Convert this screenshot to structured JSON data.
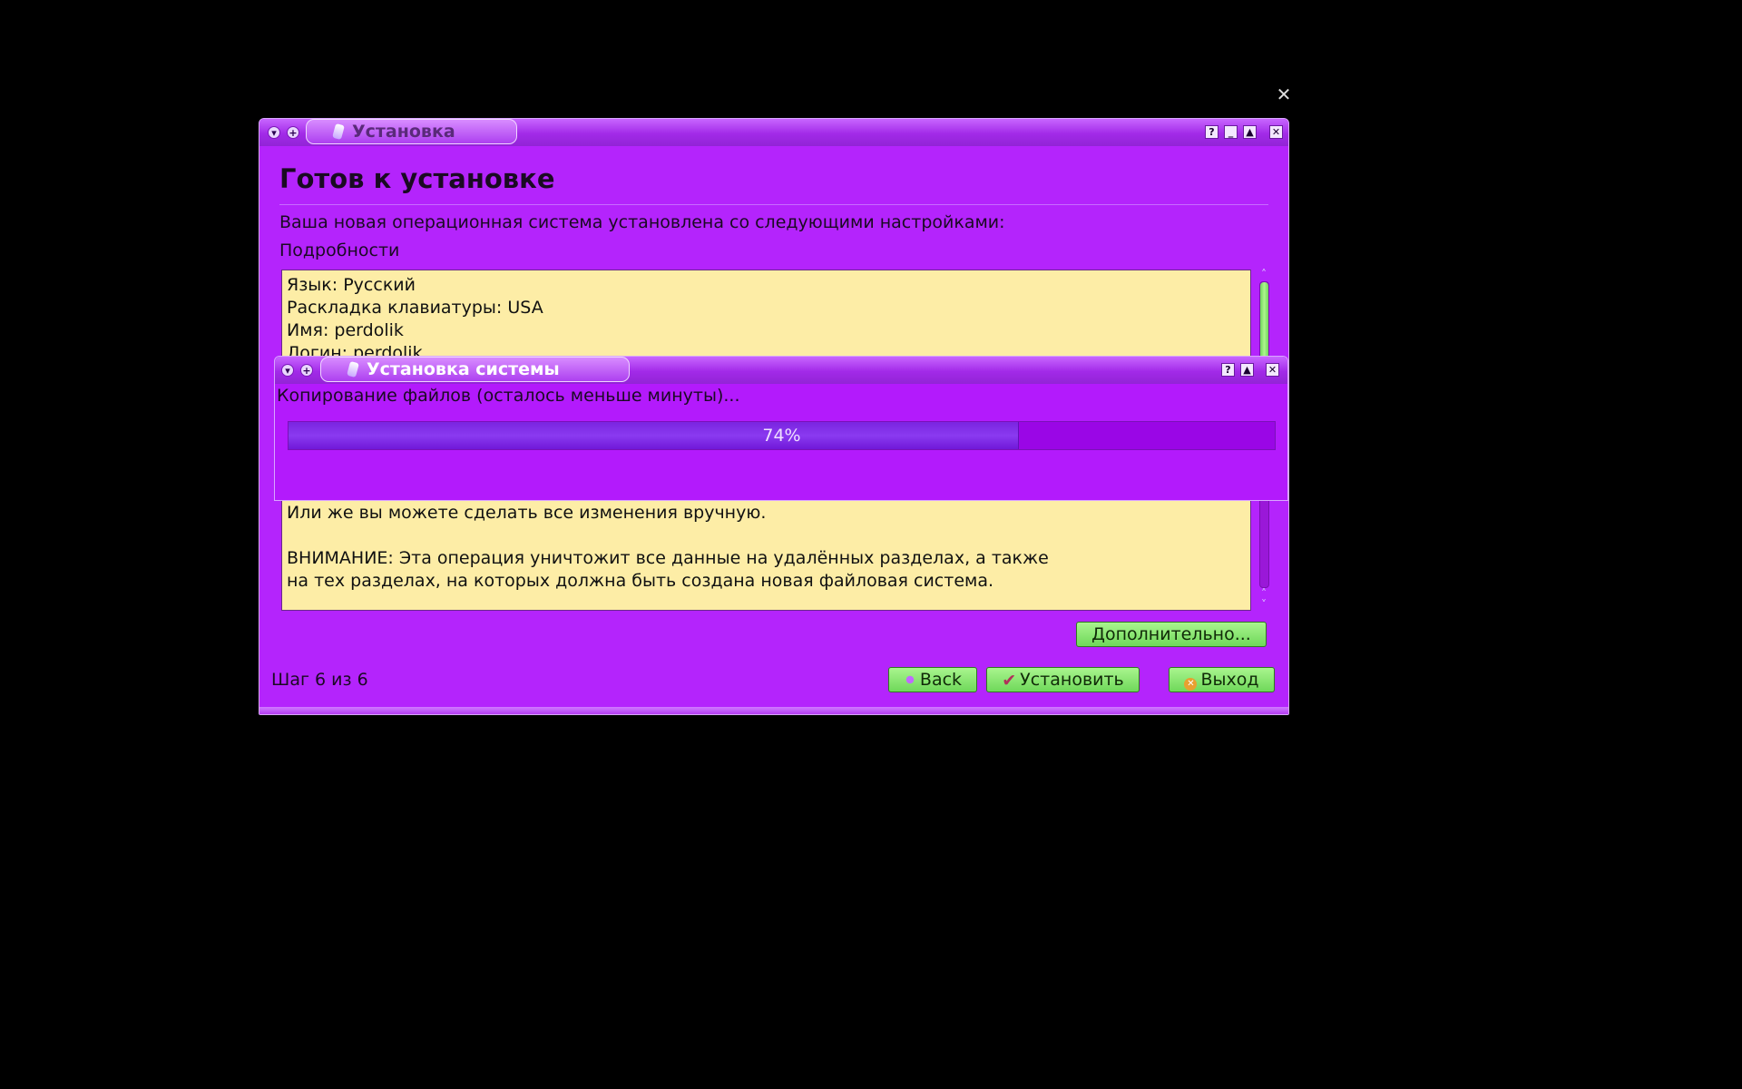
{
  "main_window": {
    "title": "Установка",
    "heading": "Готов к установке",
    "description": "Ваша новая операционная система установлена со следующими настройками:",
    "details_label": "Подробности",
    "details_lines": [
      "Язык: Русский",
      "Раскладка клавиатуры: USA",
      "Имя: perdolik",
      "Логин: perdolik"
    ],
    "details_lines_bottom": [
      "Или же вы можете сделать все изменения вручную.",
      "",
      "ВНИМАНИЕ: Эта операция уничтожит все данные на удалённых разделах, а также",
      "на тех разделах, на которых должна быть создана новая файловая система."
    ],
    "advanced_button": "Дополнительно...",
    "step_label": "Шаг 6 из 6",
    "back_button": "Back",
    "install_button": "Установить",
    "quit_button": "Выход"
  },
  "progress_dialog": {
    "title": "Установка системы",
    "message": "Копирование файлов (осталось меньше минуты)...",
    "progress_percent": 74,
    "progress_label": "74%"
  },
  "titlebar_buttons": {
    "menu": "▾",
    "sticky": "+",
    "help": "?",
    "minimize": "_",
    "maximize": "▲",
    "close": "✕"
  },
  "colors": {
    "window_bg": "#b424fc",
    "textbox_bg": "#fdeda6",
    "button_green": "#7fe066",
    "progress_fill": "#8030e8"
  }
}
